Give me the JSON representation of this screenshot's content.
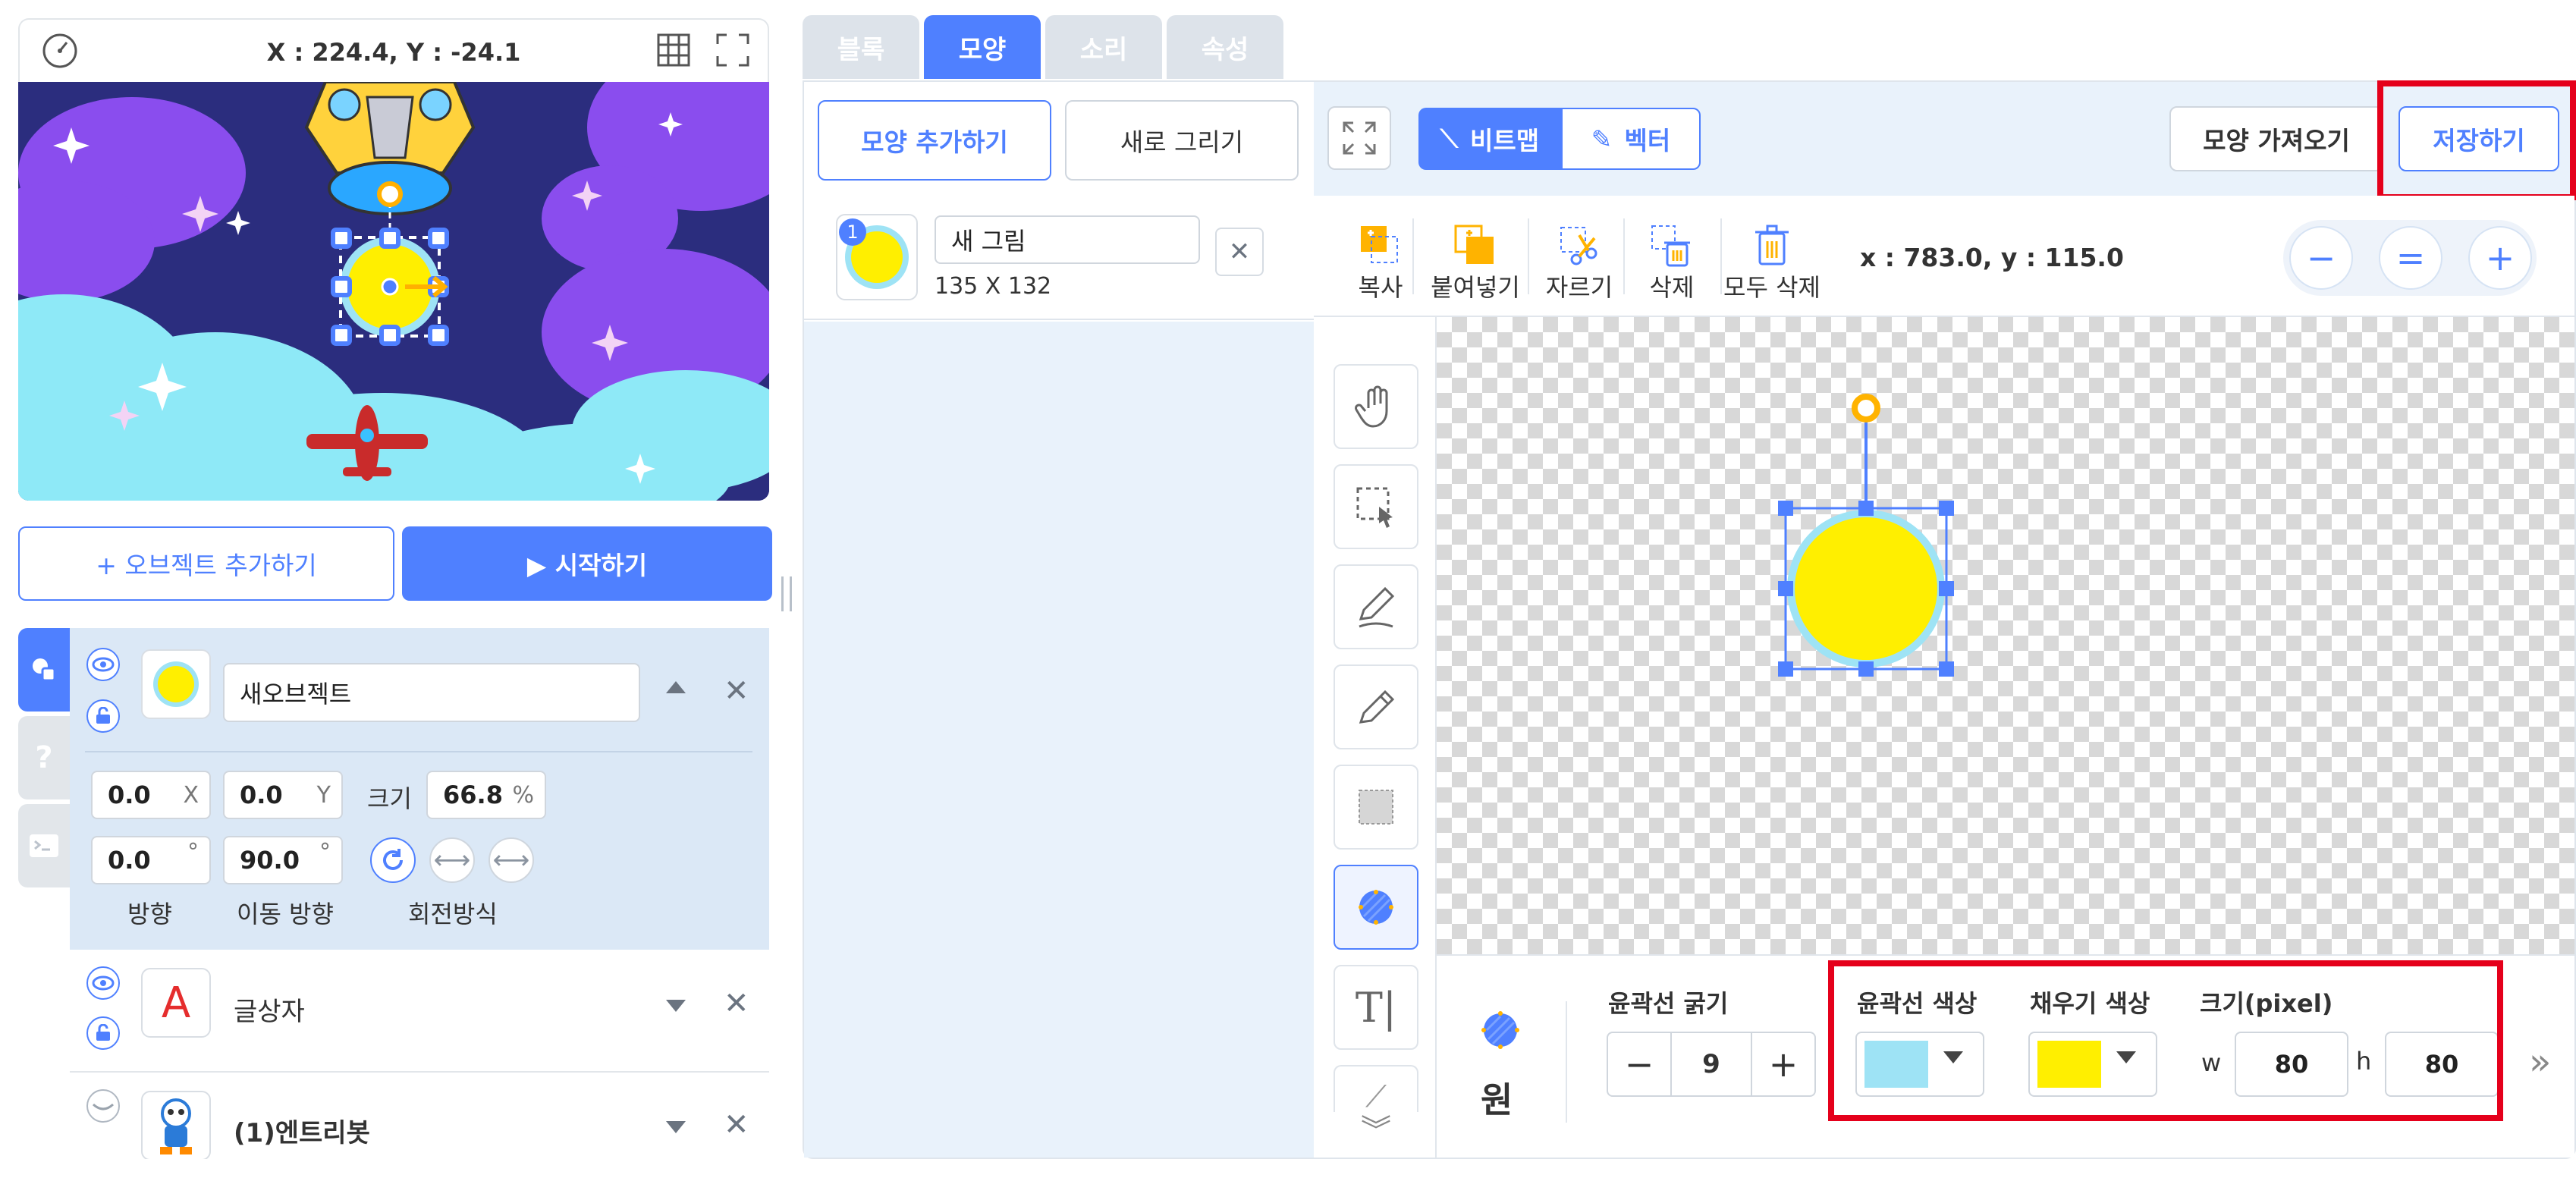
{
  "stage": {
    "coords": "X : 224.4, Y : -24.1"
  },
  "buttons": {
    "add_object": "+ 오브젝트 추가하기",
    "start": "▶ 시작하기"
  },
  "objects": [
    {
      "name": "새오브젝트",
      "x": "0.0",
      "y": "0.0",
      "x_unit": "X",
      "y_unit": "Y",
      "size_label": "크기",
      "size": "66.8",
      "size_unit": "%",
      "direction": "0.0",
      "move_direction": "90.0",
      "deg": "°",
      "direction_label": "방향",
      "move_direction_label": "이동 방향",
      "rotation_label": "회전방식"
    },
    {
      "name": "글상자",
      "thumb_text": "A"
    },
    {
      "name": "(1)엔트리봇"
    }
  ],
  "tabs": [
    "블록",
    "모양",
    "소리",
    "속성"
  ],
  "shape_panel": {
    "add_shape": "모양 추가하기",
    "new_draw": "새로 그리기",
    "item": {
      "index": "1",
      "name": "새 그림",
      "size": "135 X 132"
    }
  },
  "editor": {
    "mode_bitmap": "비트맵",
    "mode_vector": "벡터",
    "import_shape": "모양 가져오기",
    "save": "저장하기",
    "tools": [
      "복사",
      "붙여넣기",
      "자르기",
      "삭제",
      "모두 삭제"
    ],
    "cursor_coords": "x : 783.0, y : 115.0",
    "zoom": {
      "minus": "−",
      "reset": "=",
      "plus": "+"
    }
  },
  "bottom": {
    "shape_name": "원",
    "stroke_width_label": "윤곽선 굵기",
    "stroke_width": "9",
    "stroke_color_label": "윤곽선 색상",
    "fill_color_label": "채우기 색상",
    "size_label": "크기(pixel)",
    "w_label": "w",
    "w": "80",
    "h_label": "h",
    "h": "80",
    "minus": "−",
    "plus": "+",
    "more": "»"
  },
  "colors": {
    "accent": "#4f80ff",
    "stroke_color": "#9ee3f5",
    "fill_color": "#ffef00",
    "highlight": "#e5001b"
  }
}
